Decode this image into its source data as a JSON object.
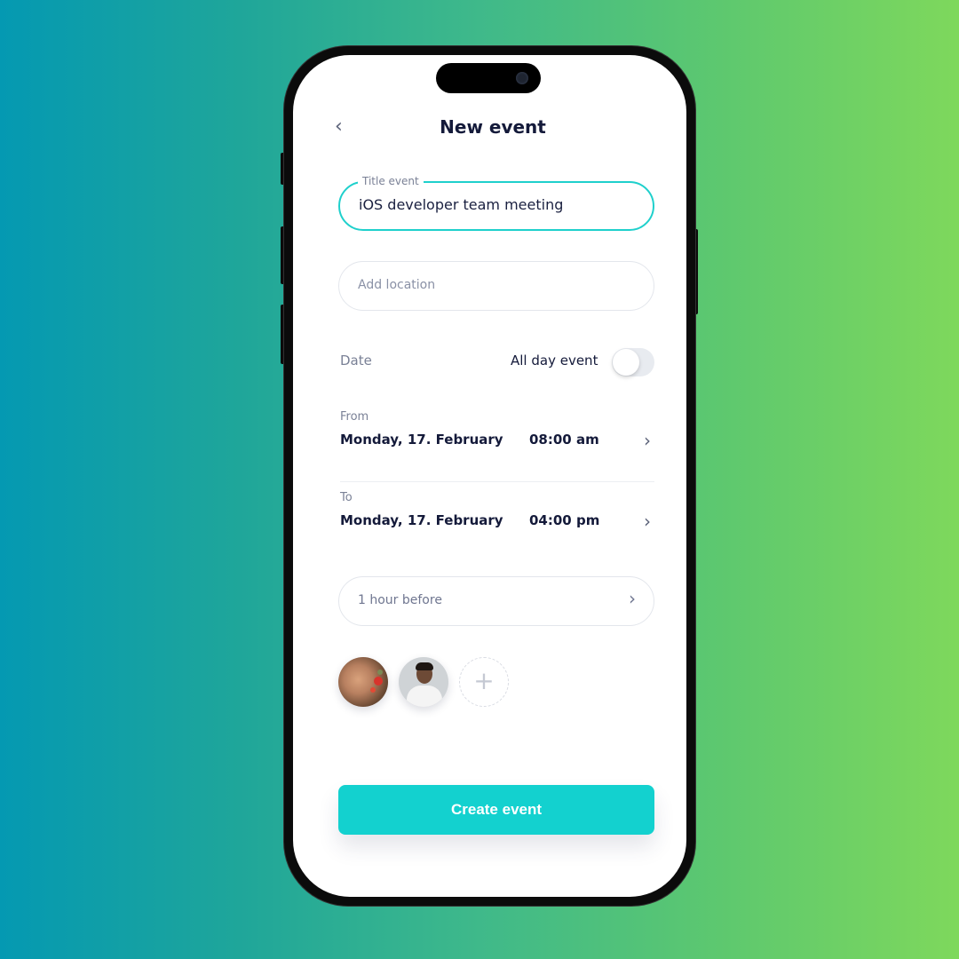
{
  "header": {
    "back_icon": "chevron-left-icon",
    "title": "New event"
  },
  "form": {
    "title_field": {
      "label": "Title event",
      "value": "iOS developer team meeting"
    },
    "location_field": {
      "placeholder": "Add location",
      "value": ""
    },
    "date_section": {
      "label": "Date",
      "all_day_label": "All day event",
      "all_day_on": false
    },
    "from": {
      "label": "From",
      "date": "Monday, 17. February",
      "time": "08:00 am"
    },
    "to": {
      "label": "To",
      "date": "Monday, 17. February",
      "time": "04:00 pm"
    },
    "reminder": {
      "value": "1 hour before"
    },
    "participants": [
      {
        "name": "participant-1"
      },
      {
        "name": "participant-2"
      }
    ],
    "add_participant_symbol": "+",
    "chevron_symbol": "›",
    "back_symbol": "‹"
  },
  "actions": {
    "create_label": "Create event"
  },
  "colors": {
    "accent": "#13d1cf",
    "title_text": "#141a3a",
    "muted_text": "#7a8196",
    "background_gradient_start": "#0499b2",
    "background_gradient_end": "#7ed85c"
  }
}
